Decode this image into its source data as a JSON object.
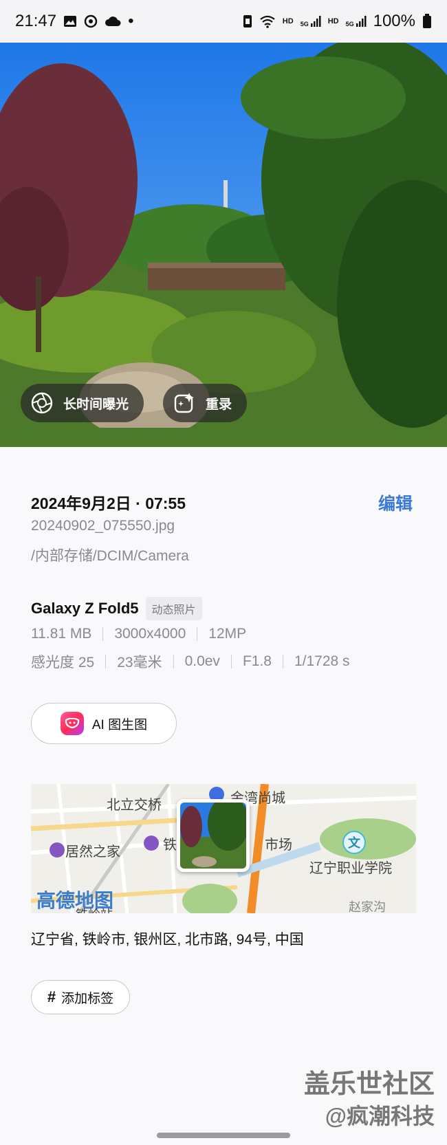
{
  "status_bar": {
    "time": "21:47",
    "dot": "•",
    "hd1": "HD",
    "net1": "5G",
    "hd2": "HD",
    "net2": "5G",
    "battery": "100%",
    "left_icons": [
      "gallery-icon",
      "sync-icon",
      "cloud-icon"
    ],
    "right_icons": [
      "nfc-icon",
      "wifi-icon",
      "signal-icon",
      "signal-icon",
      "battery-icon"
    ]
  },
  "photo_chips": {
    "long_exposure": "长时间曝光",
    "rerecord": "重录"
  },
  "details": {
    "date": "2024年9月2日 · 07:55",
    "edit": "编辑",
    "filename": "20240902_075550.jpg",
    "path": "/内部存储/DCIM/Camera",
    "device": "Galaxy Z Fold5",
    "badge": "动态照片",
    "row1": [
      "11.81 MB",
      "3000x4000",
      "12MP"
    ],
    "row2": [
      "感光度 25",
      "23毫米",
      "0.0ev",
      "F1.8",
      "1/1728 s"
    ]
  },
  "ai_button": {
    "label": "AI 图生图"
  },
  "map": {
    "labels": {
      "north_bridge": "北立交桥",
      "mall": "金湾尚城",
      "home": "居然之家",
      "iron": "铁",
      "market": "市场",
      "college_icon": "文",
      "college": "辽宁职业学院",
      "amap": "高德地图",
      "tieling": "铁岭站",
      "zhaojiagou": "赵家沟"
    }
  },
  "address": "辽宁省, 铁岭市, 银州区, 北市路, 94号, 中国",
  "tag_button": {
    "hash": "#",
    "label": "添加标签"
  },
  "watermark": {
    "line1": "盖乐世社区",
    "line2": "@疯潮科技"
  },
  "colors": {
    "accent": "#3b7ad9",
    "route": "#f28c28",
    "water": "#bcd9ee",
    "park": "#a8d08a"
  }
}
